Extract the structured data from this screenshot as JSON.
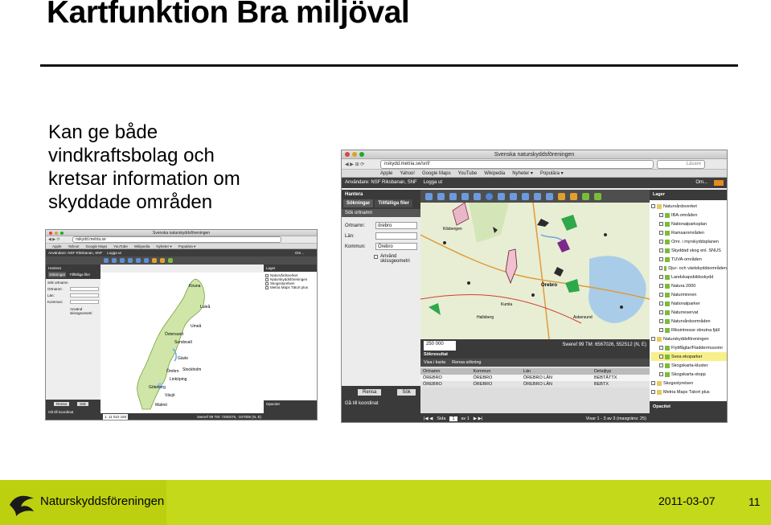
{
  "slide": {
    "title": "Kartfunktion Bra miljöval",
    "body_lines": [
      "Kan ge både",
      "vindkraftsbolag och",
      "kretsar information om",
      "skyddade områden"
    ],
    "date": "2011-03-07",
    "page_number": "11",
    "org_name": "Naturskyddsföreningen"
  },
  "screenshot_small": {
    "window_title": "Svenska naturskyddsföreningen",
    "url": "nskydd.metria.se",
    "bookmarks": [
      "Apple",
      "Yahoo!",
      "Google Maps",
      "YouTube",
      "Wikipedia",
      "Nyheter ▾",
      "Populära ▾"
    ],
    "user_text": "Användare: NSF Riksbanan, SNF",
    "logout": "Logga ut",
    "panel_title": "Hantera",
    "tabs": [
      "Sökningar",
      "Tillfälliga filer"
    ],
    "search_label": "Sök ortnamn",
    "fields": [
      "Ortnamn:",
      "Län:",
      "Kommun:"
    ],
    "checkbox": "Använd skissgeometri",
    "buttons": [
      "Rensa",
      "Sök"
    ],
    "coord_link": "Gå till koordinat",
    "scale_value": "1: 11 010 180",
    "status": "Sweref 99 TM: 7200276, -347006 (N, E)",
    "layers_title": "Lager",
    "layers": [
      "Naturvårdsverket",
      "Naturskyddsföreningen",
      "Skogsstyrelsen",
      "Metria Maps Tätort plus"
    ],
    "opacity_label": "Opacitet",
    "map_labels": [
      "Kiruna",
      "Luleå",
      "Umeå",
      "Östersund",
      "Sundsvall",
      "Gävle",
      "Örebro",
      "Stockholm",
      "Linköping",
      "Göteborg",
      "Växjö",
      "Malmö"
    ],
    "om": "Om..."
  },
  "screenshot_large": {
    "window_title": "Svenska naturskyddsföreningen",
    "url": "nskydd.metria.se/snf/",
    "search_placeholder": "Läsare",
    "bookmarks": [
      "Apple",
      "Yahoo!",
      "Google Maps",
      "YouTube",
      "Wikipedia",
      "Nyheter ▾",
      "Populära ▾"
    ],
    "user_text": "Användare: NSF Riksbanan, SNF",
    "logout": "Logga ut",
    "om": "Om...",
    "panel_title": "Hantera",
    "tabs": [
      "Sökningar",
      "Tillfälliga filer"
    ],
    "search_label": "Sök ortnamn",
    "fields": [
      {
        "label": "Ortnamn:",
        "value": "örebro"
      },
      {
        "label": "Län:",
        "value": ""
      },
      {
        "label": "Kommun:",
        "value": "Örebro"
      }
    ],
    "checkbox": "Använd skissgeometri",
    "buttons": [
      "Rensa",
      "Sök"
    ],
    "coord_link": "Gå till koordinat",
    "scale_value": "250 000",
    "status": "Sweref 99 TM: 6567026, 552512 (N, E)",
    "result_title": "Sökresultat",
    "result_actions": [
      "Visa i karta",
      "Rensa sökning"
    ],
    "result_headers": [
      "Ortnamn",
      "Kommun",
      "Län",
      "Detaljtyp"
    ],
    "result_rows": [
      [
        "ÖREBRO",
        "ÖREBRO",
        "ÖREBRO LÄN",
        "BEBTÄTTX"
      ],
      [
        "ÖREBRO",
        "ÖREBRO",
        "ÖREBRO LÄN",
        "BEBTX"
      ]
    ],
    "page_label": "Sida",
    "page_value": "1",
    "page_of": "av 1",
    "showing": "Visar 1 - 3 av 3 (maxgräns: 25)",
    "map_labels": [
      "Kilsbergen",
      "Örebro",
      "Kumla",
      "Hallsberg",
      "Askersund"
    ],
    "layers_title": "Lager",
    "layers": [
      "Naturvårdsverket",
      "IBA-områden",
      "Nationalparksplan",
      "Ramsarområden",
      "Omr. i myrskyddsplanen",
      "Skyddad skog enl. SNUS",
      "TUVA-områden",
      "Djur- och växtskyddsområden",
      "Landskapsbildsskydd",
      "Natura 2000",
      "Naturminnen",
      "Nationalparker",
      "Naturreservat",
      "Naturvårdsområden",
      "Riksintresse obrutna fjäll",
      "Naturskyddsföreningen",
      "Flyttfåglar/Fladdermusomr",
      "Svea ekoparker",
      "Skogskarta-kluster",
      "Skogskarta-stopp",
      "Skogsstyrelsen",
      "Metria Maps Tätort plus"
    ],
    "opacity_label": "Opacitet"
  },
  "colors": {
    "footer": "#c4d91a",
    "panel_dark": "#3a3a3a",
    "map_green": "#d9ecb0",
    "water": "#a9cde8"
  },
  "icons": [
    "logo-bird-icon",
    "window-buttons-icon",
    "map-tool-icon"
  ]
}
